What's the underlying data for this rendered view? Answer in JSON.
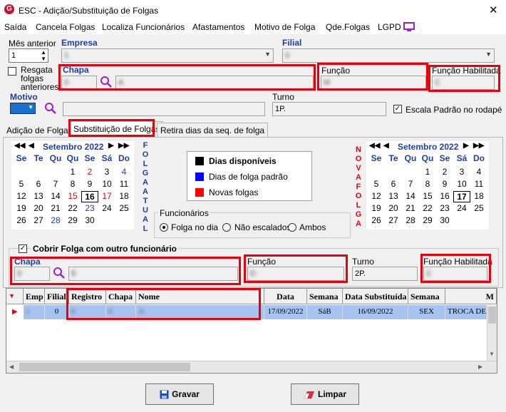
{
  "window": {
    "title": "ESC -  Adição/Substituição de Folgas",
    "logo_letter": "G",
    "close_glyph": "✕"
  },
  "menu": [
    "Saída",
    "Cancela Folgas",
    "Localiza Funcionários",
    "Afastamentos",
    "Motivo de Folga",
    "Qde.Folgas",
    "LGPD"
  ],
  "top": {
    "mes_anterior_label": "Mês anterior",
    "mes_anterior_value": "1",
    "empresa_label": "Empresa",
    "empresa_value": "1",
    "filial_label": "Filial",
    "filial_value": "0",
    "resgata_label": "Resgata folgas anteriores",
    "chapa_label": "Chapa",
    "chapa_value": "0",
    "nome_value": "A",
    "funcao_label": "Função",
    "funcao_value": "M",
    "funcao_hab_label": "Função Habilitada",
    "funcao_hab_value": "C",
    "motivo_label": "Motivo",
    "turno_label": "Turno",
    "turno_value": "1P.",
    "escala_label": "Escala Padrão no rodapé"
  },
  "tabs": [
    "Adição de Folgas",
    "Substituição de Folgas",
    "Retira dias da seq. de folga"
  ],
  "cal_left": {
    "month": "Setembro 2022",
    "dows": [
      "Se",
      "Te",
      "Qu",
      "Qu",
      "Se",
      "Sá",
      "Do"
    ],
    "selected": 16
  },
  "cal_right": {
    "month": "Setembro 2022",
    "dows": [
      "Se",
      "Te",
      "Qu",
      "Qu",
      "Se",
      "Sá",
      "Do"
    ],
    "selected": 17
  },
  "vertical_left": "FOLGA ATUAL",
  "vertical_right": "NOVA FOLGA",
  "legend": {
    "items": [
      {
        "label": "Dias disponíveis",
        "color": "#000000"
      },
      {
        "label": "Dias de folga padrão",
        "color": "#0000ff"
      },
      {
        "label": "Novas folgas",
        "color": "#ff0000"
      }
    ]
  },
  "funcionarios": {
    "label": "Funcionários",
    "options": [
      "Folga no dia",
      "Não escalados",
      "Ambos"
    ]
  },
  "cobrir": {
    "label": "Cobrir Folga com outro funcionário",
    "chapa_label": "Chapa",
    "chapa_value": "0",
    "nome_value": "E",
    "funcao_label": "Função",
    "funcao_value": "D",
    "turno_label": "Turno",
    "turno_value": "2P.",
    "funcao_hab_label": "Função Habilitada",
    "funcao_hab_value": "C"
  },
  "grid": {
    "headers": [
      "Emp",
      "Filial",
      "Registro",
      "Chapa",
      "Nome",
      "Data",
      "Semana",
      "Data Substituída",
      "Semana",
      "M"
    ],
    "row": [
      "1",
      "0",
      "0",
      "0",
      "A",
      "17/09/2022",
      "SáB",
      "16/09/2022",
      "SEX",
      "TROCA DE"
    ]
  },
  "buttons": {
    "save": "Gravar",
    "clear": "Limpar"
  }
}
